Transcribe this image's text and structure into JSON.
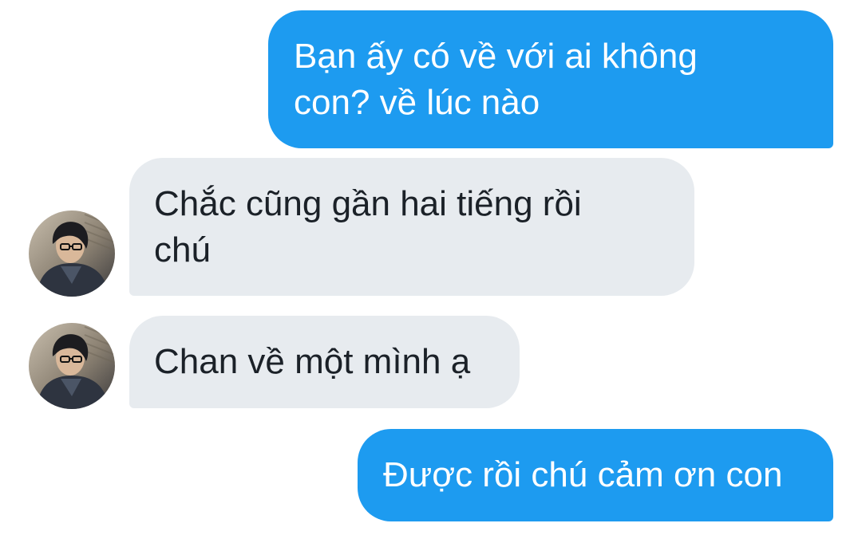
{
  "conversation": {
    "messages": [
      {
        "sender": "me",
        "text": "Bạn ấy có về với ai không\ncon? về lúc nào"
      },
      {
        "sender": "other",
        "text": "Chắc cũng gần hai tiếng rồi\nchú"
      },
      {
        "sender": "other",
        "text": "Chan về một mình ạ"
      },
      {
        "sender": "me",
        "text": "Được rồi chú cảm ơn con"
      }
    ]
  },
  "colors": {
    "outgoing_bubble": "#1d9bf0",
    "incoming_bubble": "#e7ebef",
    "outgoing_text": "#ffffff",
    "incoming_text": "#1b2128",
    "background": "#ffffff"
  },
  "icons": {
    "contact_avatar": "user-avatar-photo"
  }
}
